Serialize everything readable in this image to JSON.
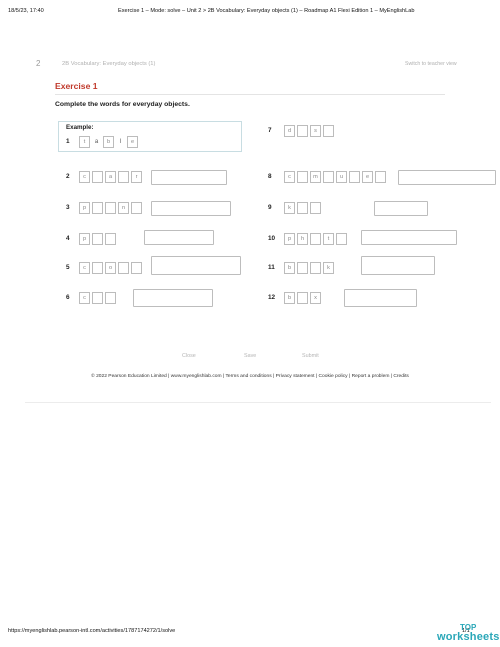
{
  "print_header": {
    "date": "18/5/23, 17:40",
    "title": "Exercise 1 – Mode: solve – Unit 2 > 2B Vocabulary: Everyday objects (1) – Roadmap A1 Flexi Edition 1 – MyEnglishLab"
  },
  "header": {
    "page_number": "2",
    "section_title": "2B Vocabulary: Everyday objects (1)",
    "teacher_link": "Switch to teacher view"
  },
  "exercise": {
    "title": "Exercise 1",
    "instruction": "Complete the words for everyday objects."
  },
  "example": {
    "label": "Example:",
    "number": "1",
    "letters": [
      "t",
      "a",
      "b",
      "l",
      "e"
    ]
  },
  "items": [
    {
      "number": "7",
      "letters": [
        "d",
        "",
        "s",
        ""
      ]
    },
    {
      "number": "2",
      "letters": [
        "c",
        "",
        "a",
        "",
        "r"
      ]
    },
    {
      "number": "8",
      "letters": [
        "c",
        "",
        "m",
        "",
        "u",
        "",
        "e",
        ""
      ]
    },
    {
      "number": "3",
      "letters": [
        "p",
        "",
        "",
        "n",
        ""
      ]
    },
    {
      "number": "9",
      "letters": [
        "k",
        "",
        ""
      ]
    },
    {
      "number": "4",
      "letters": [
        "p",
        "",
        ""
      ]
    },
    {
      "number": "10",
      "letters": [
        "p",
        "h",
        "",
        "t",
        ""
      ]
    },
    {
      "number": "5",
      "letters": [
        "c",
        "",
        "o",
        "",
        ""
      ]
    },
    {
      "number": "11",
      "letters": [
        "b",
        "",
        "",
        "k"
      ]
    },
    {
      "number": "6",
      "letters": [
        "c",
        "",
        ""
      ]
    },
    {
      "number": "12",
      "letters": [
        "b",
        "",
        "x"
      ]
    }
  ],
  "actions": {
    "close": "Close",
    "save": "Save",
    "submit": "Submit"
  },
  "footer": {
    "text": "© 2022 Pearson Education Limited | www.myenglishlab.com | Terms and conditions | Privacy statement | Cookie policy | Report a problem | Credits"
  },
  "print_footer": {
    "url": "https://myenglishlab.pearson-intl.com/activities/1787174272/1/solve",
    "page": "1/1"
  },
  "watermark": {
    "top": "TOP",
    "brand": "worksheets"
  },
  "colors": {
    "accent": "#c0392b",
    "watermark": "#2aa7b8"
  }
}
